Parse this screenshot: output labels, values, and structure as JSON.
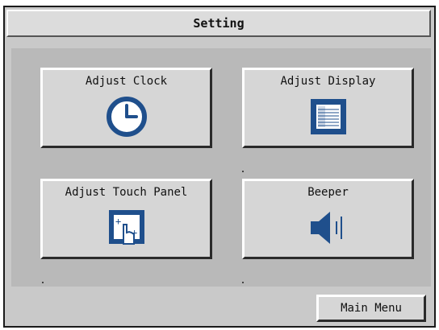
{
  "header": {
    "title": "Setting"
  },
  "tiles": [
    {
      "label": "Adjust Clock",
      "icon": "clock-icon"
    },
    {
      "label": "Adjust Display",
      "icon": "display-icon"
    },
    {
      "label": "Adjust Touch Panel",
      "icon": "touch-panel-icon"
    },
    {
      "label": "Beeper",
      "icon": "speaker-icon"
    }
  ],
  "footer": {
    "main_menu_label": "Main Menu"
  },
  "colors": {
    "icon_blue": "#1f4f8c",
    "panel_gray": "#b9b9b9",
    "button_gray": "#d6d6d6"
  }
}
